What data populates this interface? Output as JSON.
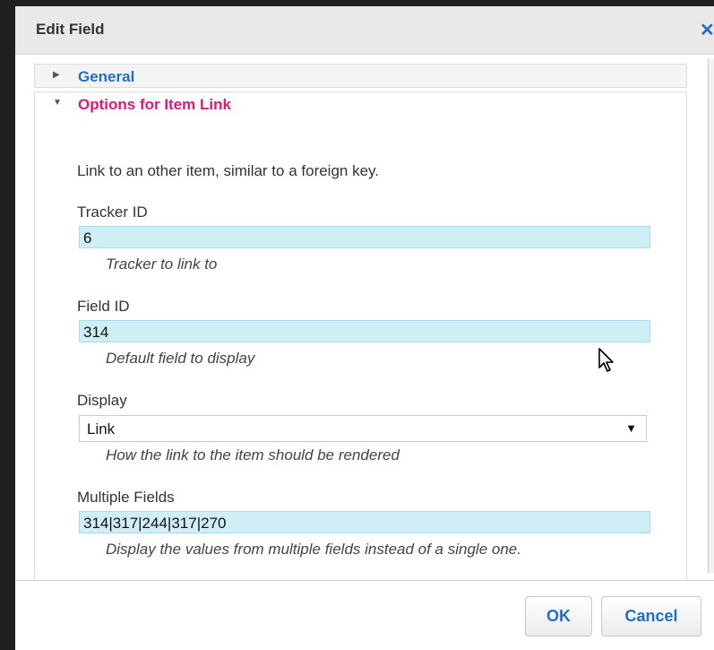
{
  "dialog": {
    "title": "Edit Field",
    "close_icon": "close-icon"
  },
  "accordion": {
    "general_label": "General",
    "options_label": "Options for Item Link"
  },
  "options": {
    "description": "Link to an other item, similar to a foreign key.",
    "tracker_id": {
      "label": "Tracker ID",
      "value": "6",
      "help": "Tracker to link to"
    },
    "field_id": {
      "label": "Field ID",
      "value": "314",
      "help": "Default field to display"
    },
    "display": {
      "label": "Display",
      "value": "Link",
      "help": "How the link to the item should be rendered"
    },
    "multiple_fields": {
      "label": "Multiple Fields",
      "value": "314|317|244|317|270",
      "help": "Display the values from multiple fields instead of a single one."
    }
  },
  "footer": {
    "ok_label": "OK",
    "cancel_label": "Cancel"
  },
  "colors": {
    "accent_blue": "#1f6fc5",
    "section_pink": "#e0187a",
    "input_bg": "#cfeef6"
  }
}
